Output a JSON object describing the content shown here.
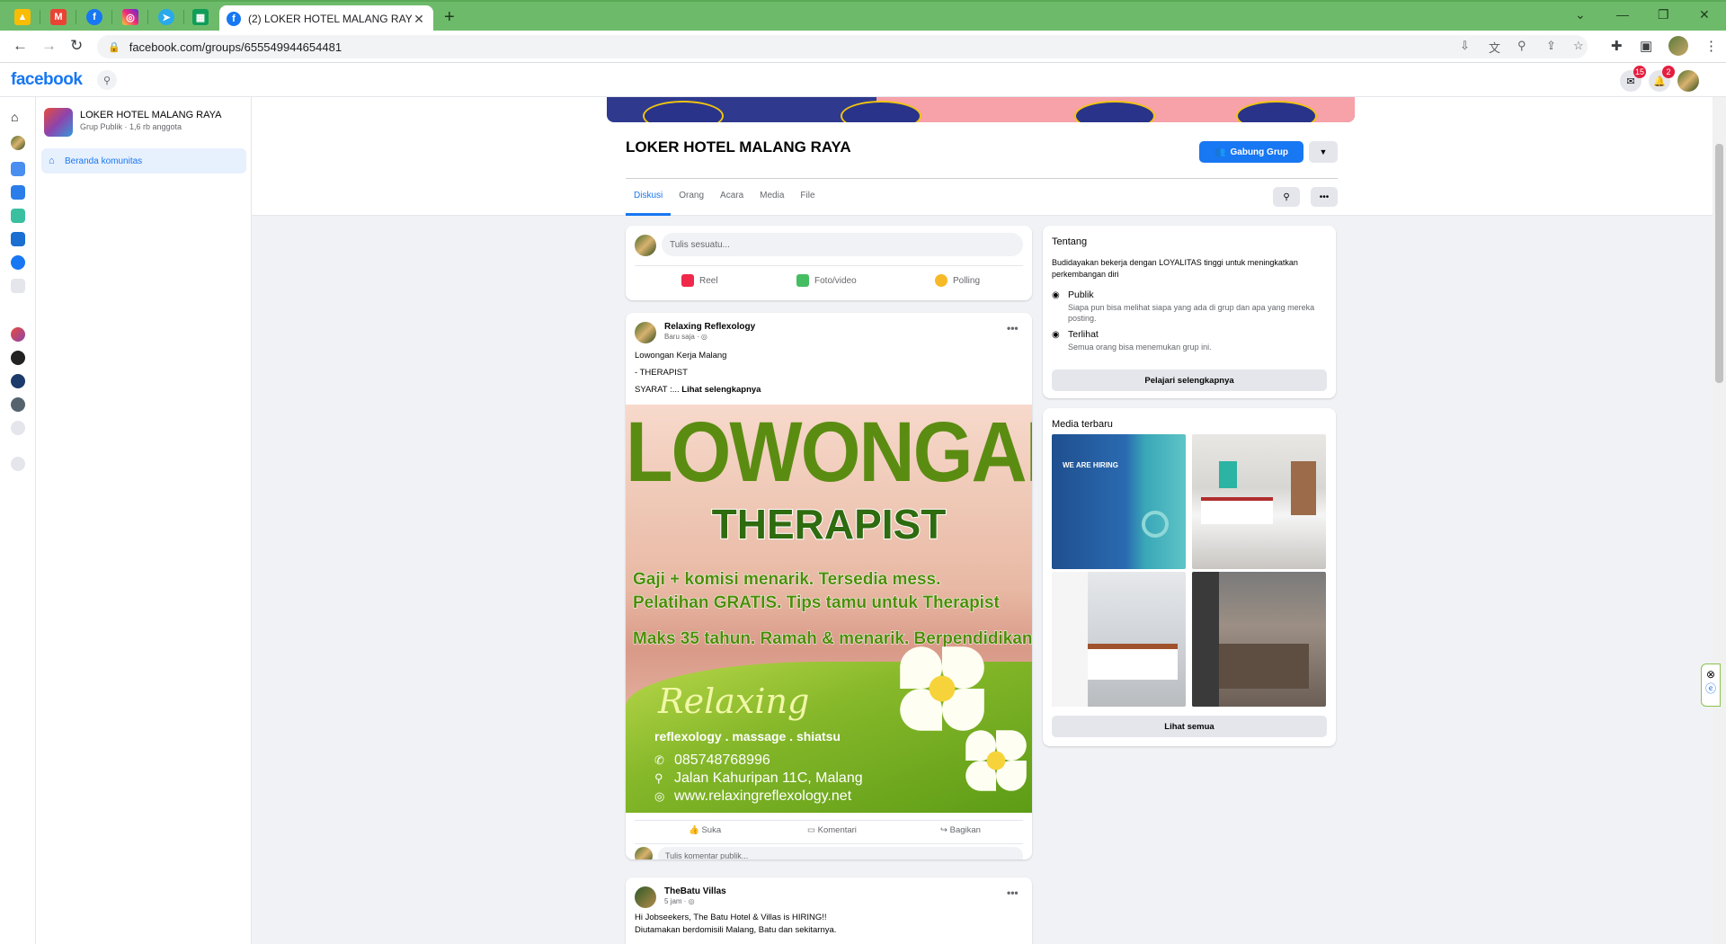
{
  "browser": {
    "active_tab_title": "(2) LOKER HOTEL MALANG RAYA",
    "url": "facebook.com/groups/655549944654481",
    "other_tabs": [
      "google-ads-icon",
      "gmail-icon",
      "facebook-icon",
      "instagram-icon",
      "telegram-icon",
      "sheets-icon"
    ]
  },
  "fb": {
    "logo": "facebook",
    "messenger_count": "15",
    "notif_count": "2"
  },
  "group": {
    "name": "LOKER HOTEL MALANG RAYA",
    "meta": "Grup Publik · 1,6 rb anggota",
    "nav_home": "Beranda komunitas",
    "title": "LOKER HOTEL MALANG RAYA",
    "join_label": "Gabung Grup",
    "tabs": [
      "Diskusi",
      "Orang",
      "Acara",
      "Media",
      "File"
    ]
  },
  "composer": {
    "placeholder": "Tulis sesuatu...",
    "reel": "Reel",
    "photo": "Foto/video",
    "poll": "Polling"
  },
  "post1": {
    "author": "Relaxing Reflexology",
    "time": "Baru saja · ",
    "line1": "Lowongan Kerja Malang",
    "line2": "- THERAPIST",
    "line3": "SYARAT :... ",
    "see_more": "Lihat selengkapnya",
    "poster": {
      "headline": "LOWONGAN",
      "role": "THERAPIST",
      "l1": "Gaji + komisi menarik. Tersedia mess.",
      "l2": "Pelatihan GRATIS. Tips tamu untuk Therapist",
      "l3": "Maks 35 tahun. Ramah & menarik. Berpendidikan",
      "brand": "Relaxing",
      "tagline": "reflexology . massage . shiatsu",
      "phone": "085748768996",
      "address": "Jalan Kahuripan 11C, Malang",
      "web": "www.relaxingreflexology.net"
    },
    "like": "Suka",
    "comment": "Komentari",
    "share": "Bagikan",
    "comment_placeholder": "Tulis komentar publik..."
  },
  "post2": {
    "author": "TheBatu Villas",
    "time": "5 jam · ",
    "line1": "Hi Jobseekers, The Batu Hotel & Villas is HIRING!!",
    "line2": "Diutamakan berdomisili Malang, Batu dan sekitarnya."
  },
  "about": {
    "heading": "Tentang",
    "desc": "Budidayakan bekerja dengan LOYALITAS tinggi untuk meningkatkan perkembangan diri",
    "public_title": "Publik",
    "public_desc": "Siapa pun bisa melihat siapa yang ada di grup dan apa yang mereka posting.",
    "visible_title": "Terlihat",
    "visible_desc": "Semua orang bisa menemukan grup ini.",
    "button": "Pelajari selengkapnya"
  },
  "media": {
    "heading": "Media terbaru",
    "button": "Lihat semua",
    "thumb1_text": "WE ARE HIRING"
  }
}
